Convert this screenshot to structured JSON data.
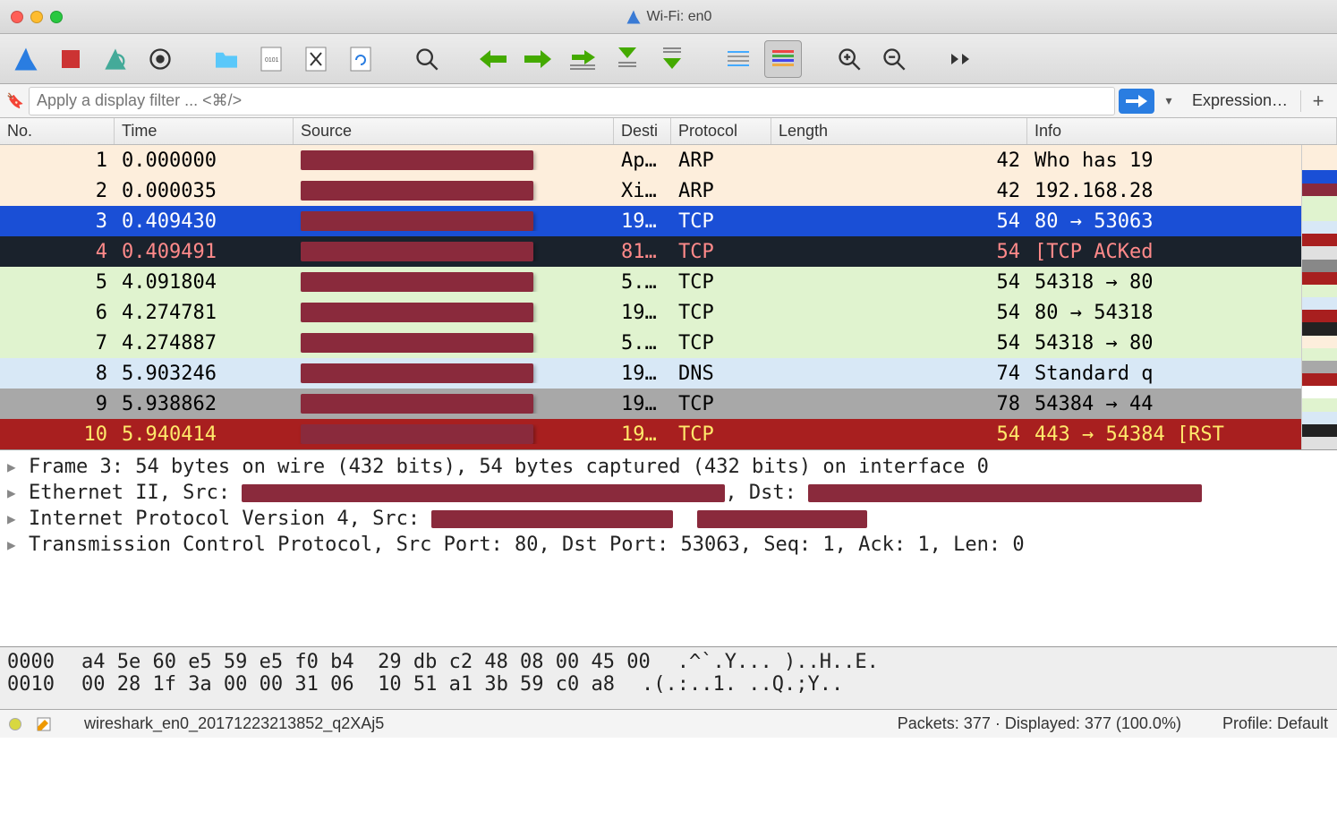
{
  "window": {
    "title": "Wi-Fi: en0"
  },
  "filter": {
    "placeholder": "Apply a display filter ... <⌘/>",
    "expression_label": "Expression…"
  },
  "columns": {
    "no": "No.",
    "time": "Time",
    "source": "Source",
    "dest": "Desti",
    "protocol": "Protocol",
    "length": "Length",
    "info": "Info"
  },
  "packets": [
    {
      "no": "1",
      "time": "0.000000",
      "dst": "Ap…",
      "proto": "ARP",
      "len": "42",
      "info": "Who has 19",
      "cls": "row-arp"
    },
    {
      "no": "2",
      "time": "0.000035",
      "dst": "Xi…",
      "proto": "ARP",
      "len": "42",
      "info": "192.168.28",
      "cls": "row-arp"
    },
    {
      "no": "3",
      "time": "0.409430",
      "dst": "19…",
      "proto": "TCP",
      "len": "54",
      "info": "80 → 53063",
      "cls": "row-sel"
    },
    {
      "no": "4",
      "time": "0.409491",
      "dst": "81…",
      "proto": "TCP",
      "len": "54",
      "info": "[TCP ACKed",
      "cls": "row-dark"
    },
    {
      "no": "5",
      "time": "4.091804",
      "dst": "5.…",
      "proto": "TCP",
      "len": "54",
      "info": "54318 → 80",
      "cls": "row-grn"
    },
    {
      "no": "6",
      "time": "4.274781",
      "dst": "19…",
      "proto": "TCP",
      "len": "54",
      "info": "80 → 54318",
      "cls": "row-grn"
    },
    {
      "no": "7",
      "time": "4.274887",
      "dst": "5.…",
      "proto": "TCP",
      "len": "54",
      "info": "54318 → 80",
      "cls": "row-grn"
    },
    {
      "no": "8",
      "time": "5.903246",
      "dst": "19…",
      "proto": "DNS",
      "len": "74",
      "info": "Standard q",
      "cls": "row-dns"
    },
    {
      "no": "9",
      "time": "5.938862",
      "dst": "19…",
      "proto": "TCP",
      "len": "78",
      "info": "54384 → 44",
      "cls": "row-gray"
    },
    {
      "no": "10",
      "time": "5.940414",
      "dst": "19…",
      "proto": "TCP",
      "len": "54",
      "info": "443 → 54384 [RST",
      "cls": "row-red"
    }
  ],
  "details": {
    "frame": "Frame 3: 54 bytes on wire (432 bits), 54 bytes captured (432 bits) on interface 0",
    "eth_pre": "Ethernet II, Src: ",
    "eth_mid": ", Dst: ",
    "ip_pre": "Internet Protocol Version 4, Src: ",
    "tcp": "Transmission Control Protocol, Src Port: 80, Dst Port: 53063, Seq: 1, Ack: 1, Len: 0"
  },
  "hex": {
    "r0_off": "0000",
    "r0_hex": "a4 5e 60 e5 59 e5 f0 b4  29 db c2 48 08 00 45 00",
    "r0_asc": ".^`.Y... )..H..E.",
    "r1_off": "0010",
    "r1_hex": "00 28 1f 3a 00 00 31 06  10 51 a1 3b 59 c0 a8",
    "r1_asc": ".(.:..1. ..Q.;Y.."
  },
  "status": {
    "file": "wireshark_en0_20171223213852_q2XAj5",
    "packets": "Packets: 377 · Displayed: 377 (100.0%)",
    "profile": "Profile: Default"
  },
  "minimap_colors": [
    "#fdeedc",
    "#fdeedc",
    "#1a4fd6",
    "#8a2a3c",
    "#e0f3cf",
    "#e0f3cf",
    "#d8e8f6",
    "#a81f1f",
    "#e0e0e0",
    "#888",
    "#a81f1f",
    "#e0f3cf",
    "#d8e8f6",
    "#a81f1f",
    "#222",
    "#fdeedc",
    "#e0f3cf",
    "#a8a8a8",
    "#a81f1f",
    "#fff",
    "#e0f3cf",
    "#d8e8f6",
    "#222",
    "#e0e0e0"
  ]
}
